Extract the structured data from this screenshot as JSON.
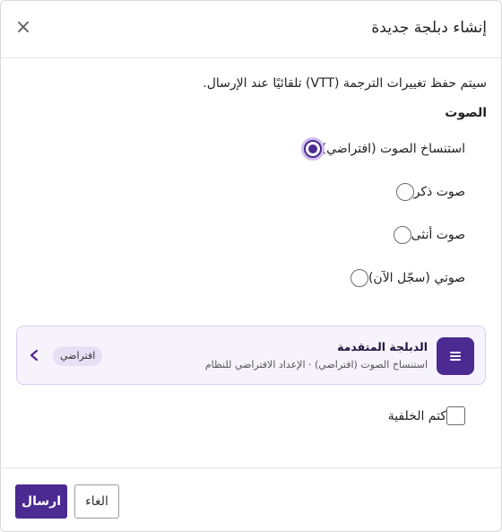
{
  "dialog": {
    "title": "إنشاء دبلجة جديدة",
    "close_icon": "close-icon"
  },
  "info_text": "سيتم حفظ تغييرات الترجمة (VTT) تلقائيًا عند الإرسال.",
  "voice": {
    "label": "الصوت",
    "options": [
      {
        "label": "استنساخ الصوت (افتراضي)",
        "checked": true
      },
      {
        "label": "صوت ذكر",
        "checked": false
      },
      {
        "label": "صوت أنثى",
        "checked": false
      },
      {
        "label": "صوتي (سجّل الآن)",
        "checked": false
      }
    ]
  },
  "advanced": {
    "title": "الدبلجة المتقدمة",
    "subtitle": "استنساخ الصوت (افتراضي) · الإعداد الافتراضي للنظام",
    "badge": "افتراضي",
    "icon": "list-icon",
    "chevron_icon": "chevron-left-icon"
  },
  "mute_background": {
    "label": "كتم الخلفية",
    "checked": false
  },
  "footer": {
    "submit_label": "ارسال",
    "cancel_label": "الغاء"
  },
  "colors": {
    "accent": "#4b2a91",
    "accent_light": "#f6f3fc",
    "badge_bg": "#e6e0f5"
  }
}
